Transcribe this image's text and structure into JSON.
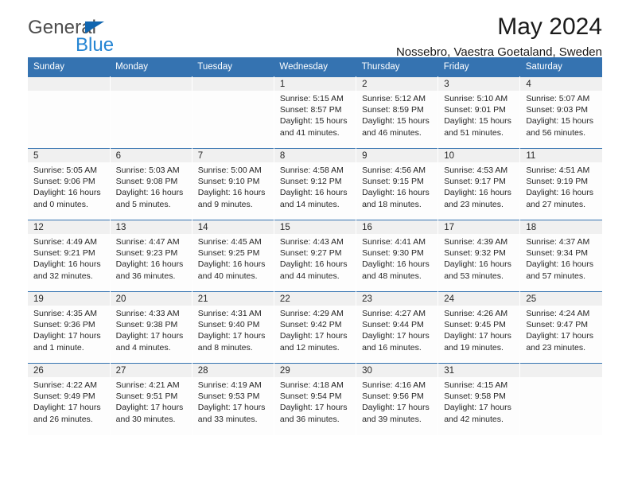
{
  "brand": {
    "name_top": "General",
    "name_bottom": "Blue",
    "logo_icon": "triangle-icon"
  },
  "header": {
    "title": "May 2024",
    "subtitle": "Nossebro, Vaestra Goetaland, Sweden"
  },
  "colors": {
    "header_blue": "#3573b1",
    "brand_blue": "#2585d3",
    "logo_triangle": "#1166b0",
    "daynum_band": "#f0f0f0",
    "cell_bg": "#fdfdfd",
    "text": "#262626"
  },
  "calendar": {
    "weekday_headers": [
      "Sunday",
      "Monday",
      "Tuesday",
      "Wednesday",
      "Thursday",
      "Friday",
      "Saturday"
    ],
    "weeks": [
      [
        {
          "day": "",
          "lines": []
        },
        {
          "day": "",
          "lines": []
        },
        {
          "day": "",
          "lines": []
        },
        {
          "day": "1",
          "lines": [
            "Sunrise: 5:15 AM",
            "Sunset: 8:57 PM",
            "Daylight: 15 hours",
            "and 41 minutes."
          ]
        },
        {
          "day": "2",
          "lines": [
            "Sunrise: 5:12 AM",
            "Sunset: 8:59 PM",
            "Daylight: 15 hours",
            "and 46 minutes."
          ]
        },
        {
          "day": "3",
          "lines": [
            "Sunrise: 5:10 AM",
            "Sunset: 9:01 PM",
            "Daylight: 15 hours",
            "and 51 minutes."
          ]
        },
        {
          "day": "4",
          "lines": [
            "Sunrise: 5:07 AM",
            "Sunset: 9:03 PM",
            "Daylight: 15 hours",
            "and 56 minutes."
          ]
        }
      ],
      [
        {
          "day": "5",
          "lines": [
            "Sunrise: 5:05 AM",
            "Sunset: 9:06 PM",
            "Daylight: 16 hours",
            "and 0 minutes."
          ]
        },
        {
          "day": "6",
          "lines": [
            "Sunrise: 5:03 AM",
            "Sunset: 9:08 PM",
            "Daylight: 16 hours",
            "and 5 minutes."
          ]
        },
        {
          "day": "7",
          "lines": [
            "Sunrise: 5:00 AM",
            "Sunset: 9:10 PM",
            "Daylight: 16 hours",
            "and 9 minutes."
          ]
        },
        {
          "day": "8",
          "lines": [
            "Sunrise: 4:58 AM",
            "Sunset: 9:12 PM",
            "Daylight: 16 hours",
            "and 14 minutes."
          ]
        },
        {
          "day": "9",
          "lines": [
            "Sunrise: 4:56 AM",
            "Sunset: 9:15 PM",
            "Daylight: 16 hours",
            "and 18 minutes."
          ]
        },
        {
          "day": "10",
          "lines": [
            "Sunrise: 4:53 AM",
            "Sunset: 9:17 PM",
            "Daylight: 16 hours",
            "and 23 minutes."
          ]
        },
        {
          "day": "11",
          "lines": [
            "Sunrise: 4:51 AM",
            "Sunset: 9:19 PM",
            "Daylight: 16 hours",
            "and 27 minutes."
          ]
        }
      ],
      [
        {
          "day": "12",
          "lines": [
            "Sunrise: 4:49 AM",
            "Sunset: 9:21 PM",
            "Daylight: 16 hours",
            "and 32 minutes."
          ]
        },
        {
          "day": "13",
          "lines": [
            "Sunrise: 4:47 AM",
            "Sunset: 9:23 PM",
            "Daylight: 16 hours",
            "and 36 minutes."
          ]
        },
        {
          "day": "14",
          "lines": [
            "Sunrise: 4:45 AM",
            "Sunset: 9:25 PM",
            "Daylight: 16 hours",
            "and 40 minutes."
          ]
        },
        {
          "day": "15",
          "lines": [
            "Sunrise: 4:43 AM",
            "Sunset: 9:27 PM",
            "Daylight: 16 hours",
            "and 44 minutes."
          ]
        },
        {
          "day": "16",
          "lines": [
            "Sunrise: 4:41 AM",
            "Sunset: 9:30 PM",
            "Daylight: 16 hours",
            "and 48 minutes."
          ]
        },
        {
          "day": "17",
          "lines": [
            "Sunrise: 4:39 AM",
            "Sunset: 9:32 PM",
            "Daylight: 16 hours",
            "and 53 minutes."
          ]
        },
        {
          "day": "18",
          "lines": [
            "Sunrise: 4:37 AM",
            "Sunset: 9:34 PM",
            "Daylight: 16 hours",
            "and 57 minutes."
          ]
        }
      ],
      [
        {
          "day": "19",
          "lines": [
            "Sunrise: 4:35 AM",
            "Sunset: 9:36 PM",
            "Daylight: 17 hours",
            "and 1 minute."
          ]
        },
        {
          "day": "20",
          "lines": [
            "Sunrise: 4:33 AM",
            "Sunset: 9:38 PM",
            "Daylight: 17 hours",
            "and 4 minutes."
          ]
        },
        {
          "day": "21",
          "lines": [
            "Sunrise: 4:31 AM",
            "Sunset: 9:40 PM",
            "Daylight: 17 hours",
            "and 8 minutes."
          ]
        },
        {
          "day": "22",
          "lines": [
            "Sunrise: 4:29 AM",
            "Sunset: 9:42 PM",
            "Daylight: 17 hours",
            "and 12 minutes."
          ]
        },
        {
          "day": "23",
          "lines": [
            "Sunrise: 4:27 AM",
            "Sunset: 9:44 PM",
            "Daylight: 17 hours",
            "and 16 minutes."
          ]
        },
        {
          "day": "24",
          "lines": [
            "Sunrise: 4:26 AM",
            "Sunset: 9:45 PM",
            "Daylight: 17 hours",
            "and 19 minutes."
          ]
        },
        {
          "day": "25",
          "lines": [
            "Sunrise: 4:24 AM",
            "Sunset: 9:47 PM",
            "Daylight: 17 hours",
            "and 23 minutes."
          ]
        }
      ],
      [
        {
          "day": "26",
          "lines": [
            "Sunrise: 4:22 AM",
            "Sunset: 9:49 PM",
            "Daylight: 17 hours",
            "and 26 minutes."
          ]
        },
        {
          "day": "27",
          "lines": [
            "Sunrise: 4:21 AM",
            "Sunset: 9:51 PM",
            "Daylight: 17 hours",
            "and 30 minutes."
          ]
        },
        {
          "day": "28",
          "lines": [
            "Sunrise: 4:19 AM",
            "Sunset: 9:53 PM",
            "Daylight: 17 hours",
            "and 33 minutes."
          ]
        },
        {
          "day": "29",
          "lines": [
            "Sunrise: 4:18 AM",
            "Sunset: 9:54 PM",
            "Daylight: 17 hours",
            "and 36 minutes."
          ]
        },
        {
          "day": "30",
          "lines": [
            "Sunrise: 4:16 AM",
            "Sunset: 9:56 PM",
            "Daylight: 17 hours",
            "and 39 minutes."
          ]
        },
        {
          "day": "31",
          "lines": [
            "Sunrise: 4:15 AM",
            "Sunset: 9:58 PM",
            "Daylight: 17 hours",
            "and 42 minutes."
          ]
        },
        {
          "day": "",
          "lines": []
        }
      ]
    ]
  }
}
